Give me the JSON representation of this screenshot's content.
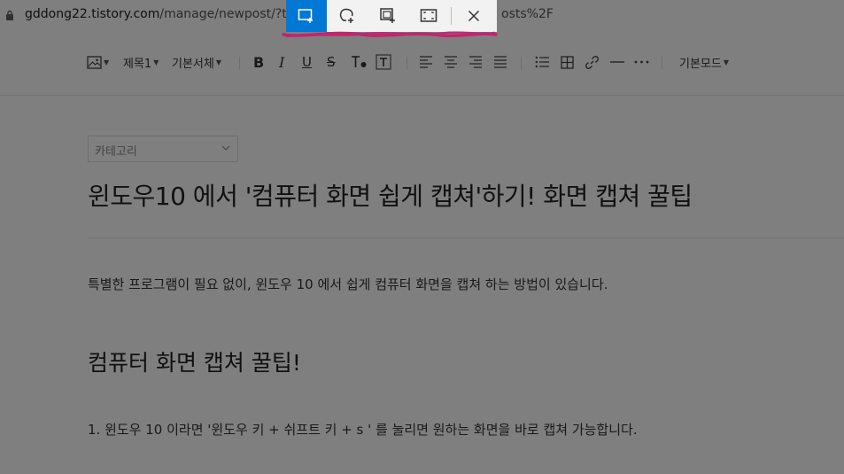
{
  "browser": {
    "url_host": "gddong22.tistory.com",
    "url_path": "/manage/newpost/?type",
    "url_tail": "osts%2F"
  },
  "toolbar": {
    "image_icon": "image-icon",
    "heading_label": "제목1",
    "font_label": "기본서체",
    "mode_label": "기본모드",
    "format_icons": [
      "bold-icon",
      "italic-icon",
      "underline-icon",
      "strikethrough-icon",
      "text-color-icon",
      "text-background-icon"
    ],
    "align_icons": [
      "align-left-icon",
      "align-center-icon",
      "align-right-icon",
      "align-justify-icon"
    ],
    "insert_icons": [
      "list-icon",
      "table-icon",
      "link-icon",
      "divider-icon",
      "more-icon"
    ]
  },
  "editor": {
    "category_placeholder": "카테고리",
    "title": "윈도우10 에서 '컴퓨터 화면 쉽게 캡쳐'하기!  화면 캡쳐 꿀팁",
    "paragraph1": "특별한 프로그램이 필요 없이, 윈도우 10 에서 쉽게 컴퓨터 화면을 캡쳐 하는 방법이 있습니다.",
    "heading2": "컴퓨터 화면 캡쳐 꿀팁!",
    "paragraph2": "1. 윈도우 10 이라면  '윈도우 키 +  쉬프트 키 + s ' 를 눌리면 원하는 화면을 바로 캡쳐 가능합니다."
  },
  "snip_toolbar": {
    "buttons": [
      "rectangular-snip-icon",
      "freeform-snip-icon",
      "window-snip-icon",
      "fullscreen-snip-icon",
      "close-icon"
    ],
    "accent_color": "#0078d4",
    "highlight_color": "#c2256e"
  }
}
